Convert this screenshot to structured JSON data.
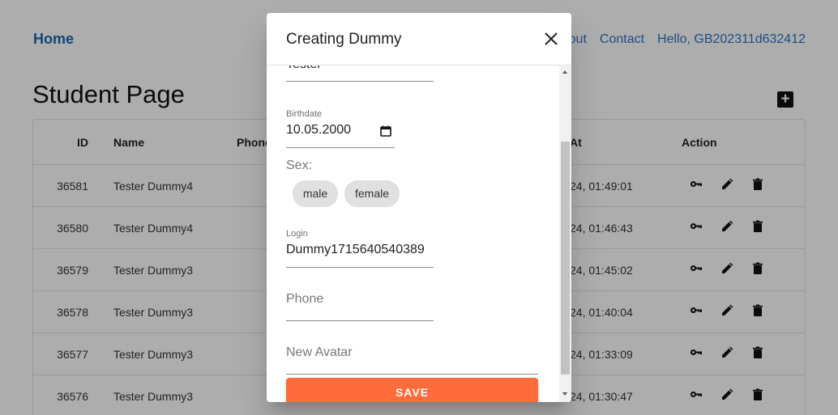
{
  "nav": {
    "home": "Home",
    "links": [
      "About",
      "Contact",
      "Hello, GB202311d632412"
    ]
  },
  "page": {
    "title": "Student Page",
    "add_icon": "add-box-icon"
  },
  "table": {
    "headers": {
      "id": "ID",
      "name": "Name",
      "phone": "Phone",
      "at": "At",
      "action": "Action"
    },
    "rows": [
      {
        "id": "36581",
        "name": "Tester Dummy4",
        "at": "24, 01:49:01"
      },
      {
        "id": "36580",
        "name": "Tester Dummy4",
        "at": "24, 01:46:43"
      },
      {
        "id": "36579",
        "name": "Tester Dummy3",
        "at": "24, 01:45:02"
      },
      {
        "id": "36578",
        "name": "Tester Dummy3",
        "at": "24, 01:40:04"
      },
      {
        "id": "36577",
        "name": "Tester Dummy3",
        "at": "24, 01:33:09"
      },
      {
        "id": "36576",
        "name": "Tester Dummy3",
        "at": "24, 01:30:47"
      }
    ],
    "row_actions": [
      "key-icon",
      "edit-icon",
      "delete-icon"
    ]
  },
  "modal": {
    "title": "Creating Dummy",
    "close_icon": "close-icon",
    "surname_value": "Tester",
    "birthdate_label": "Birthdate",
    "birthdate_value": "10.05.2000",
    "sex_label": "Sex:",
    "sex_options": [
      "male",
      "female"
    ],
    "login_label": "Login",
    "login_value": "Dummy1715640540389",
    "phone_placeholder": "Phone",
    "avatar_placeholder": "New Avatar",
    "save_label": "SAVE"
  },
  "colors": {
    "nav_link": "#2a73c4",
    "save_button": "#ff6b3b",
    "overlay": "rgba(0,0,0,0.32)"
  }
}
